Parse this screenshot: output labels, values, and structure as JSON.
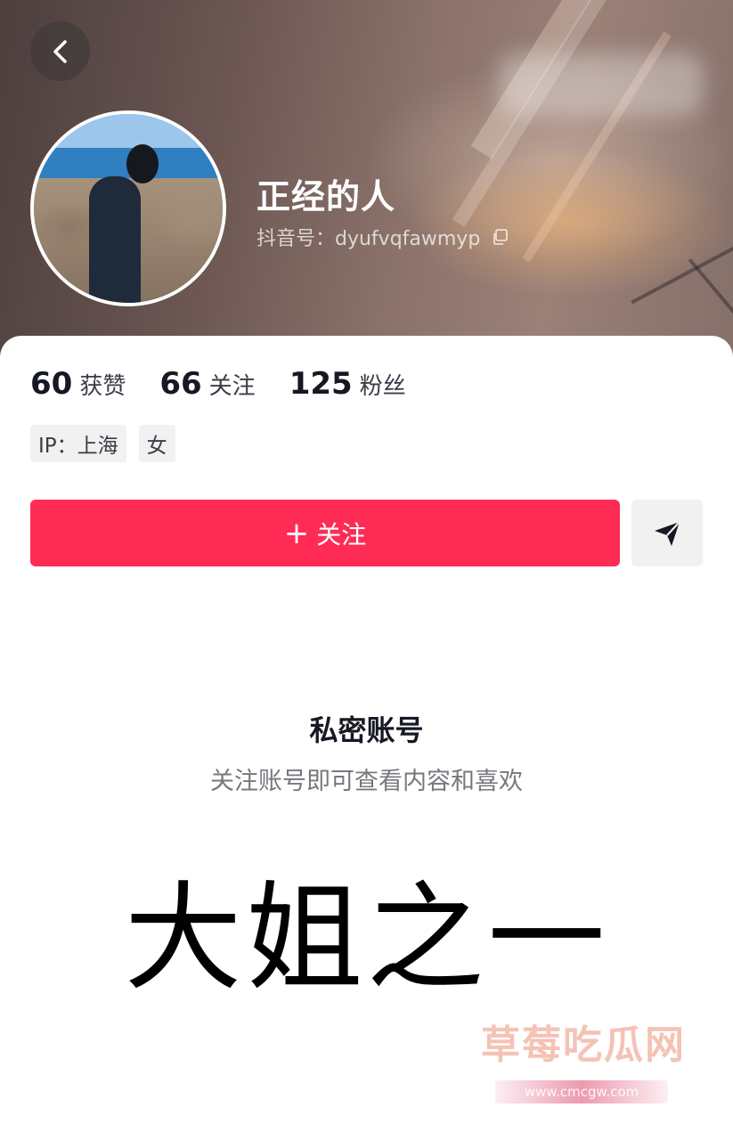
{
  "header": {
    "nickname": "正经的人",
    "douyin_id": "抖音号：dyufvqfawmyp",
    "back_icon": "chevron-left-icon",
    "copy_icon": "copy-icon"
  },
  "stats": [
    {
      "num": "60",
      "label": "获赞"
    },
    {
      "num": "66",
      "label": "关注"
    },
    {
      "num": "125",
      "label": "粉丝"
    }
  ],
  "tags": [
    {
      "text": "IP：上海"
    },
    {
      "text": "女"
    }
  ],
  "actions": {
    "follow_plus": "+",
    "follow_label": "关注",
    "message_icon": "send-icon",
    "follow_color": "#fe2c55"
  },
  "private": {
    "title": "私密账号",
    "subtitle": "关注账号即可查看内容和喜欢"
  },
  "caption": "大姐之一",
  "watermark": {
    "text": "草莓吃瓜网",
    "url": "www.cmcgw.com"
  }
}
